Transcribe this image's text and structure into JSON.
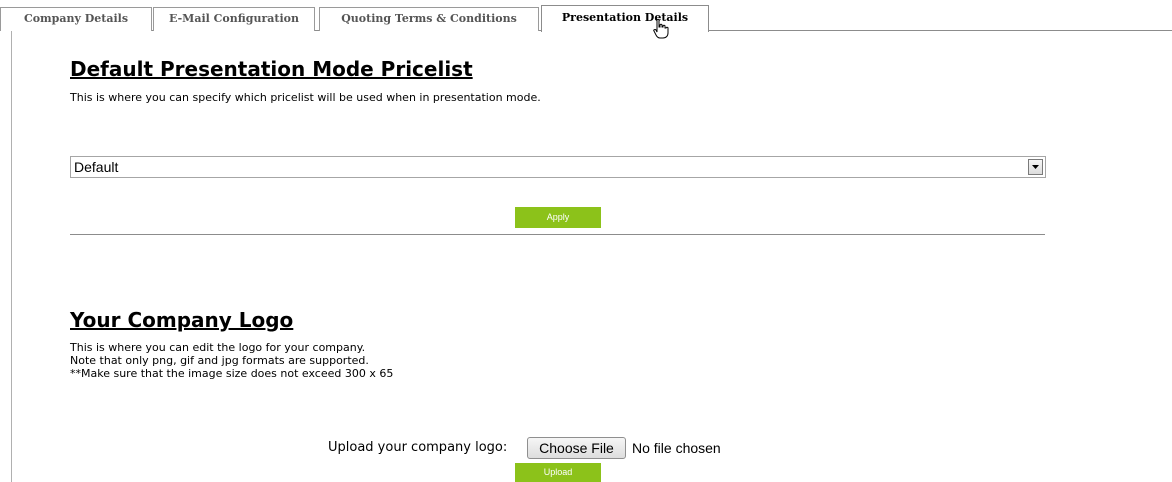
{
  "tabs": [
    {
      "label": "Company Details",
      "active": false
    },
    {
      "label": "E-Mail Configuration",
      "active": false
    },
    {
      "label": "Quoting Terms & Conditions",
      "active": false
    },
    {
      "label": "Presentation Details",
      "active": true
    }
  ],
  "pricelist_section": {
    "title": "Default Presentation Mode Pricelist",
    "description": "This is where you can specify which pricelist will be used when in presentation mode.",
    "select_value": "Default",
    "apply_label": "Apply"
  },
  "logo_section": {
    "title": "Your Company Logo",
    "description_lines": [
      "This is where you can edit the logo for your company.",
      "Note that only png, gif and jpg formats are supported.",
      "**Make sure that the image size does not exceed 300 x 65"
    ],
    "upload_label": "Upload your company logo:",
    "choose_file_label": "Choose File",
    "no_file_text": "No file chosen",
    "upload_button_label": "Upload"
  },
  "colors": {
    "accent_green": "#8cc21a",
    "tab_border": "#9a9a9a"
  },
  "icons": {
    "select_arrow": "chevron-down-icon",
    "pointer": "hand-cursor-icon"
  }
}
